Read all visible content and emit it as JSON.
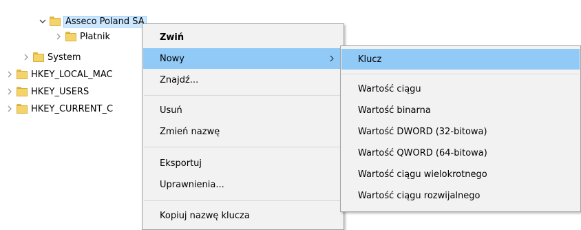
{
  "tree": {
    "items": [
      {
        "label": "Asseco Poland SA",
        "expanded": true
      },
      {
        "label": "Płatnik"
      },
      {
        "label": "System"
      },
      {
        "label": "HKEY_LOCAL_MAC"
      },
      {
        "label": "HKEY_USERS"
      },
      {
        "label": "HKEY_CURRENT_C"
      }
    ]
  },
  "context_menu": {
    "items": [
      {
        "label": "Zwiń"
      },
      {
        "label": "Nowy"
      },
      {
        "label": "Znajdź..."
      },
      {
        "label": "Usuń"
      },
      {
        "label": "Zmień nazwę"
      },
      {
        "label": "Eksportuj"
      },
      {
        "label": "Uprawnienia..."
      },
      {
        "label": "Kopiuj nazwę klucza"
      }
    ],
    "submenu_arrow": "›"
  },
  "submenu": {
    "items": [
      {
        "label": "Klucz"
      },
      {
        "label": "Wartość ciągu"
      },
      {
        "label": "Wartość binarna"
      },
      {
        "label": "Wartość DWORD (32-bitowa)"
      },
      {
        "label": "Wartość QWORD (64-bitowa)"
      },
      {
        "label": "Wartość ciągu wielokrotnego"
      },
      {
        "label": "Wartość ciągu rozwijalnego"
      }
    ]
  },
  "icons": {
    "expanded": "chevron-down-icon",
    "collapsed": "chevron-right-icon",
    "folder": "folder-icon"
  },
  "colors": {
    "highlight": "#91c9f7",
    "selection": "#cce8ff",
    "menu_bg": "#f2f2f2"
  }
}
